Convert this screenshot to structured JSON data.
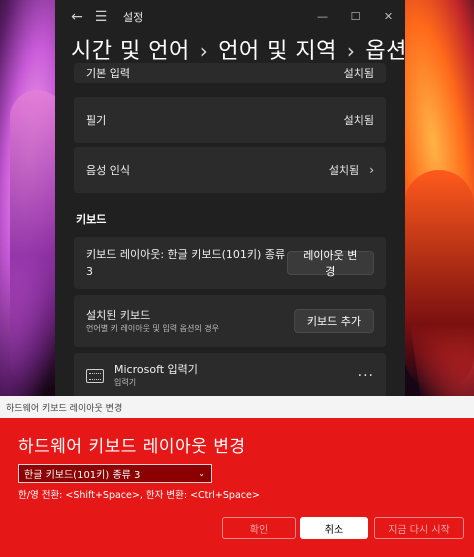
{
  "window": {
    "title": "설정",
    "back_icon": "←",
    "menu_icon": "☰",
    "minimize_icon": "—",
    "maximize_icon": "☐",
    "close_icon": "✕"
  },
  "breadcrumb": [
    "시간 및 언어",
    "언어 및 지역",
    "옵션"
  ],
  "breadcrumb_sep": "›",
  "rows": {
    "basic_input": {
      "label": "기본 입력",
      "value": "설치됨"
    },
    "handwriting": {
      "label": "필기",
      "value": "설치됨"
    },
    "speech": {
      "label": "음성 인식",
      "value": "설치됨",
      "chevron": "›"
    }
  },
  "keyboard_section": {
    "title": "키보드",
    "layout_row": {
      "label": "키보드 레이아웃: 한글 키보드(101키) 종류 3",
      "button": "레이아웃 변경"
    },
    "installed_row": {
      "label": "설치된 키보드",
      "sub": "언어별 키 레이아웃 및 입력 옵션의 경우",
      "button": "키보드 추가"
    },
    "ms_ime": {
      "label": "Microsoft 입력기",
      "sub": "입력기",
      "more": "···"
    }
  },
  "dialog": {
    "titlebar": "하드웨어 키보드 레이아웃 변경",
    "heading": "하드웨어 키보드 레이아웃 변경",
    "select_value": "한글 키보드(101키) 종류 3",
    "select_arrow": "⌄",
    "hint": "한/영 전환: <Shift+Space>, 한자 변환: <Ctrl+Space>",
    "buttons": {
      "ok": "확인",
      "cancel": "취소",
      "restart": "지금 다시 시작"
    }
  }
}
